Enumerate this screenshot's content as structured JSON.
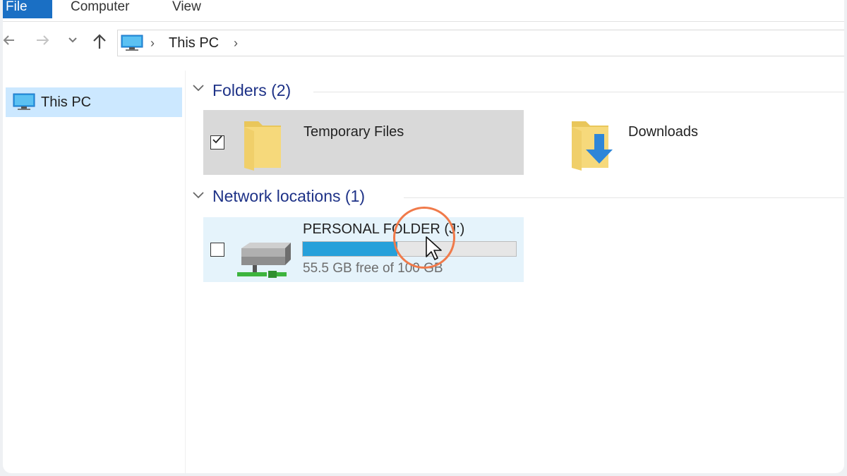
{
  "ribbon": {
    "tabs": [
      "File",
      "Computer",
      "View"
    ]
  },
  "nav": {
    "back_icon": "back-arrow-icon",
    "forward_icon": "forward-arrow-icon",
    "recent_icon": "chevron-down-icon",
    "up_icon": "up-arrow-icon",
    "breadcrumb_label": "This PC",
    "breadcrumb_sep": "›"
  },
  "sidebar": {
    "items": [
      {
        "label": "This PC",
        "icon": "computer-icon",
        "selected": true
      }
    ]
  },
  "content": {
    "groups": [
      {
        "header": "Folders (2)",
        "items": [
          {
            "name": "Temporary Files",
            "icon": "folder-icon",
            "checked": true,
            "selected": true
          },
          {
            "name": "Downloads",
            "icon": "downloads-folder-icon",
            "checked": false,
            "selected": false
          }
        ]
      },
      {
        "header": "Network locations (1)",
        "items": [
          {
            "name": "PERSONAL FOLDER (J:)",
            "icon": "network-drive-icon",
            "checked": false,
            "hovered": true,
            "usage_text": "55.5 GB free of 100 GB",
            "used_fraction": 0.445
          }
        ]
      }
    ]
  },
  "colors": {
    "accent": "#1a6fc4",
    "selection": "#cce8ff",
    "usage_fill": "#26a0da",
    "highlight_ring": "#f07a4a",
    "group_header": "#1e3287"
  }
}
